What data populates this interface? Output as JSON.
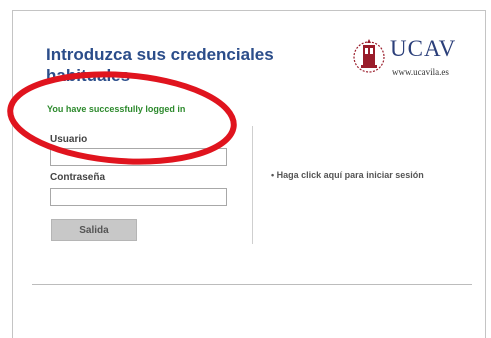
{
  "header": {
    "title": "Introduzca sus credenciales habituales",
    "logo_name": "UCAV",
    "logo_url": "www.ucavila.es"
  },
  "status_message": "You have successfully logged in",
  "form": {
    "username_label": "Usuario",
    "username_value": "",
    "password_label": "Contraseña",
    "password_value": "",
    "submit_label": "Salida"
  },
  "side": {
    "login_link": "• Haga click aquí para iniciar sesión"
  },
  "colors": {
    "title": "#2b4d8a",
    "status": "#2d8a2d",
    "annotation": "#e0141e"
  },
  "icons": {
    "logo_seal": "ucav-seal-icon"
  }
}
